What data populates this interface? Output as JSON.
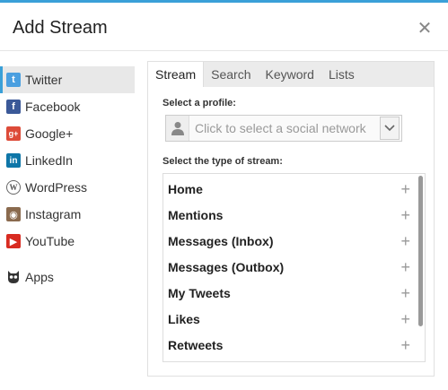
{
  "dialog": {
    "title": "Add Stream",
    "close_glyph": "✕"
  },
  "sidebar": {
    "items": [
      {
        "label": "Twitter",
        "icon": "twitter-icon",
        "glyph": "t"
      },
      {
        "label": "Facebook",
        "icon": "facebook-icon",
        "glyph": "f"
      },
      {
        "label": "Google+",
        "icon": "google-plus-icon",
        "glyph": "g+"
      },
      {
        "label": "LinkedIn",
        "icon": "linkedin-icon",
        "glyph": "in"
      },
      {
        "label": "WordPress",
        "icon": "wordpress-icon",
        "glyph": "W"
      },
      {
        "label": "Instagram",
        "icon": "instagram-icon",
        "glyph": "◉"
      },
      {
        "label": "YouTube",
        "icon": "youtube-icon",
        "glyph": "▶"
      },
      {
        "label": "Apps",
        "icon": "owl-apps-icon",
        "glyph": "🦉"
      }
    ],
    "active_index": 0
  },
  "tabs": [
    {
      "label": "Stream"
    },
    {
      "label": "Search"
    },
    {
      "label": "Keyword"
    },
    {
      "label": "Lists"
    }
  ],
  "form": {
    "profile_label": "Select a profile:",
    "profile_placeholder": "Click to select a social network",
    "stream_type_label": "Select the type of stream:"
  },
  "streams": [
    {
      "label": "Home"
    },
    {
      "label": "Mentions"
    },
    {
      "label": "Messages (Inbox)"
    },
    {
      "label": "Messages (Outbox)"
    },
    {
      "label": "My Tweets"
    },
    {
      "label": "Likes"
    },
    {
      "label": "Retweets"
    }
  ],
  "colors": {
    "accent": "#3aa0d8",
    "panel_bg": "#ebebeb",
    "twitter": "#4a9fe0",
    "facebook": "#3b5998",
    "google_plus": "#dd4b39",
    "linkedin": "#0e76a8",
    "youtube": "#d82b21"
  }
}
